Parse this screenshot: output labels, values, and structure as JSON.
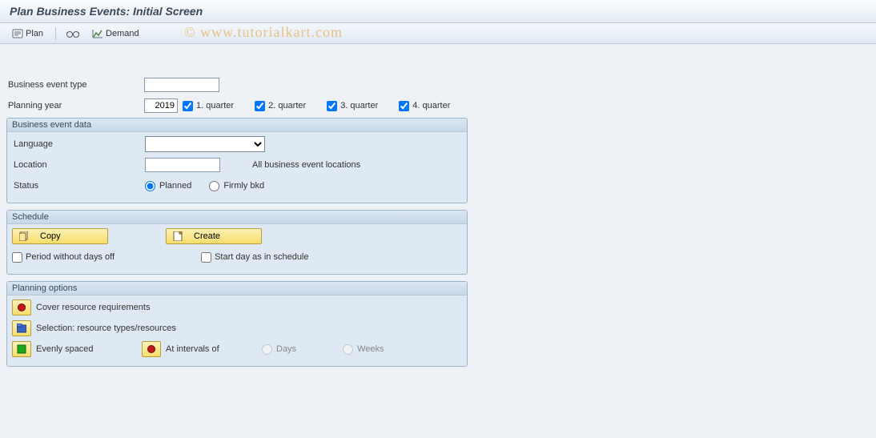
{
  "title": "Plan Business Events: Initial Screen",
  "toolbar": {
    "plan": "Plan",
    "demand": "Demand"
  },
  "watermark": "© www.tutorialkart.com",
  "form": {
    "business_event_type_label": "Business event type",
    "business_event_type_value": "",
    "planning_year_label": "Planning year",
    "planning_year_value": "2019",
    "quarters": {
      "q1": {
        "label": "1. quarter",
        "checked": true
      },
      "q2": {
        "label": "2. quarter",
        "checked": true
      },
      "q3": {
        "label": "3. quarter",
        "checked": true
      },
      "q4": {
        "label": "4. quarter",
        "checked": true
      }
    }
  },
  "bed": {
    "title": "Business event data",
    "language_label": "Language",
    "language_value": "",
    "location_label": "Location",
    "location_value": "",
    "location_hint": "All business event locations",
    "status_label": "Status",
    "status_planned": "Planned",
    "status_firm": "Firmly bkd"
  },
  "schedule": {
    "title": "Schedule",
    "copy": "Copy",
    "create": "Create",
    "period_off": "Period without days off",
    "start_day": "Start day as in schedule"
  },
  "plan_opts": {
    "title": "Planning options",
    "cover": "Cover resource requirements",
    "selection": "Selection: resource types/resources",
    "evenly": "Evenly spaced",
    "intervals": "At intervals of",
    "days": "Days",
    "weeks": "Weeks"
  }
}
